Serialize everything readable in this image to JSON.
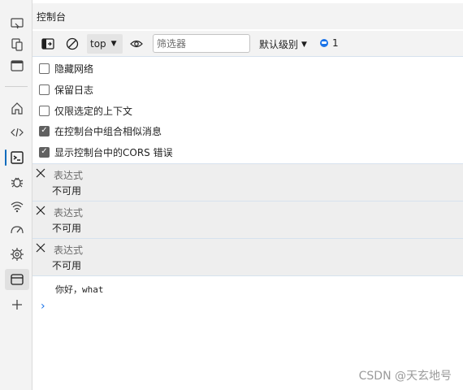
{
  "panel": {
    "title": "控制台"
  },
  "toolbar": {
    "context": "top",
    "filter_placeholder": "筛选器",
    "levels_label": "默认级别",
    "message_count": "1"
  },
  "settings": [
    {
      "label": "隐藏网络",
      "checked": false
    },
    {
      "label": "保留日志",
      "checked": false
    },
    {
      "label": "仅限选定的上下文",
      "checked": false
    },
    {
      "label": "在控制台中组合相似消息",
      "checked": true
    },
    {
      "label": "显示控制台中的CORS 错误",
      "checked": true
    }
  ],
  "watches": [
    {
      "expression": "表达式",
      "value": "不可用"
    },
    {
      "expression": "表达式",
      "value": "不可用"
    },
    {
      "expression": "表达式",
      "value": "不可用"
    }
  ],
  "console": {
    "log": "你好，what",
    "prompt": "›"
  },
  "watermark": "CSDN @天玄地号",
  "colors": {
    "accent": "#0f6cbd",
    "prompt": "#1a73e8"
  },
  "activity_icons": [
    "screencast-icon",
    "device-emulation-icon",
    "dock-icon",
    "home-icon",
    "elements-icon",
    "console-icon",
    "debug-icon",
    "network-icon",
    "performance-icon",
    "settings-icon",
    "application-icon",
    "add-icon"
  ]
}
